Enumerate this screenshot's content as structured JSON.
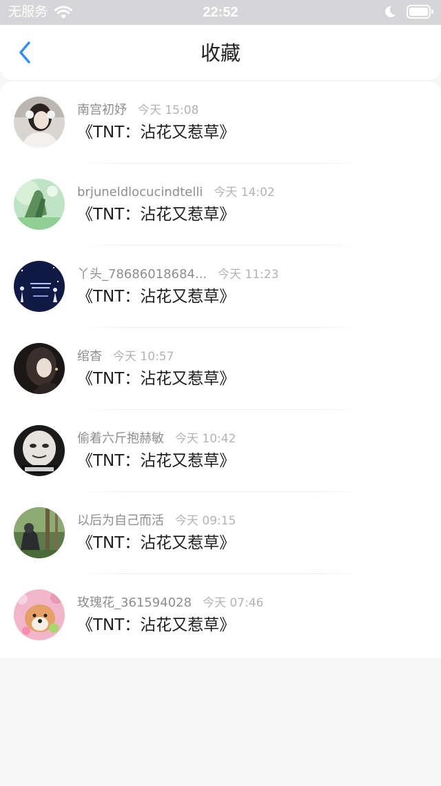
{
  "status_bar": {
    "carrier": "无服务",
    "time": "22:52",
    "icons": [
      "wifi-icon",
      "moon-icon",
      "battery-icon"
    ]
  },
  "header": {
    "title": "收藏",
    "back_icon": "chevron-left-icon",
    "accent_color": "#2f8ef4"
  },
  "favorites": [
    {
      "name": "南宫初妤",
      "time": "今天 15:08",
      "song": "《TNT：沾花又惹草》",
      "avatar": "avatar-girl-headphones"
    },
    {
      "name": "brjuneldlocucindtelli",
      "time": "今天 14:02",
      "song": "《TNT：沾花又惹草》",
      "avatar": "avatar-green-painting"
    },
    {
      "name": "丫头_78686018684...",
      "time": "今天 11:23",
      "song": "《TNT：沾花又惹草》",
      "avatar": "avatar-blue-night"
    },
    {
      "name": "绾杳",
      "time": "今天 10:57",
      "song": "《TNT：沾花又惹草》",
      "avatar": "avatar-dark-portrait"
    },
    {
      "name": "偷着六斤抱赫敏",
      "time": "今天 10:42",
      "song": "《TNT：沾花又惹草》",
      "avatar": "avatar-meme-face"
    },
    {
      "name": "以后为自己而活",
      "time": "今天 09:15",
      "song": "《TNT：沾花又惹草》",
      "avatar": "avatar-forest"
    },
    {
      "name": "玫瑰花_361594028",
      "time": "今天 07:46",
      "song": "《TNT：沾花又惹草》",
      "avatar": "avatar-shiba-dog"
    }
  ]
}
